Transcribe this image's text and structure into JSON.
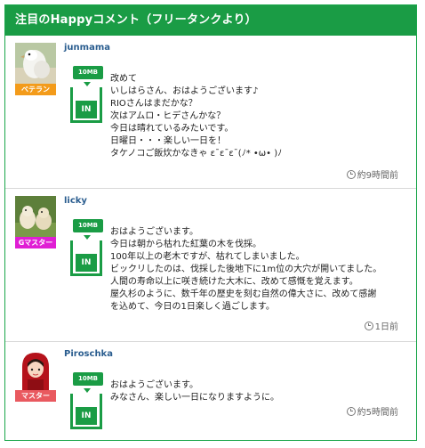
{
  "header": {
    "title": "注目のHappyコメント（フリータンクより）"
  },
  "comments": [
    {
      "username": "junmama",
      "rank": "ベテラン",
      "rank_color": "#f39b1a",
      "tank": {
        "label": "10MB",
        "status": "IN"
      },
      "avatar_icon": "bird-avatar-icon",
      "text": "改めて\nいしはらさん、おはようございます♪\nRIOさんはまだかな？\n次はアムロ・ヒデさんかな？\n今日は晴れているみたいです。\n日曜日・・・楽しい一日を！\nタケノコご飯炊かなきゃ ε¯ε¯ε¯(ﾉ* •ω• )ﾉ",
      "time": "約9時間前"
    },
    {
      "username": "licky",
      "rank": "Gマスター",
      "rank_color": "#e01ed4",
      "tank": {
        "label": "10MB",
        "status": "IN"
      },
      "avatar_icon": "dogs-avatar-icon",
      "text": "おはようございます。\n今日は朝から枯れた紅葉の木を伐採。\n100年以上の老木ですが、枯れてしまいました。\nビックリしたのは、伐採した後地下に1m位の大穴が開いてました。\n人間の寿命以上に咲き続けた大木に、改めて感慨を覚えます。\n屋久杉のように、数千年の歴史を刻む自然の偉大さに、改めて感謝\nを込めて、今日の1日楽しく過ごします。",
      "time": "1日前"
    },
    {
      "username": "Piroschka",
      "rank": "マスター",
      "rank_color": "#e9595f",
      "tank": {
        "label": "10MB",
        "status": "IN"
      },
      "avatar_icon": "girl-red-hood-avatar-icon",
      "text": "おはようございます。\nみなさん、楽しい一日になりますように。",
      "time": "約5時間前"
    }
  ]
}
